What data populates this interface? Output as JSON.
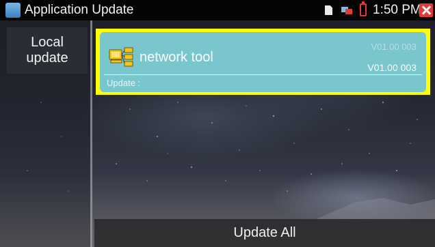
{
  "statusbar": {
    "title": "Application Update",
    "time": "1:50 PM"
  },
  "icons": {
    "app": "settings-app-icon",
    "sd_card": "sd-card-icon",
    "network": "network-status-icon",
    "battery": "battery-icon",
    "close": "close-icon",
    "tool": "network-tool-icon"
  },
  "colors": {
    "highlight": "#ffff00",
    "card": "#79c6cd",
    "close": "#e53935",
    "battery": "#e53935"
  },
  "sidebar": {
    "local_update_line1": "Local",
    "local_update_line2": "update"
  },
  "apps": [
    {
      "name": "network tool",
      "version_current": "V01.00 003",
      "version_new": "V01.00 003",
      "update_label": "Update :"
    }
  ],
  "footer": {
    "update_all": "Update All"
  }
}
